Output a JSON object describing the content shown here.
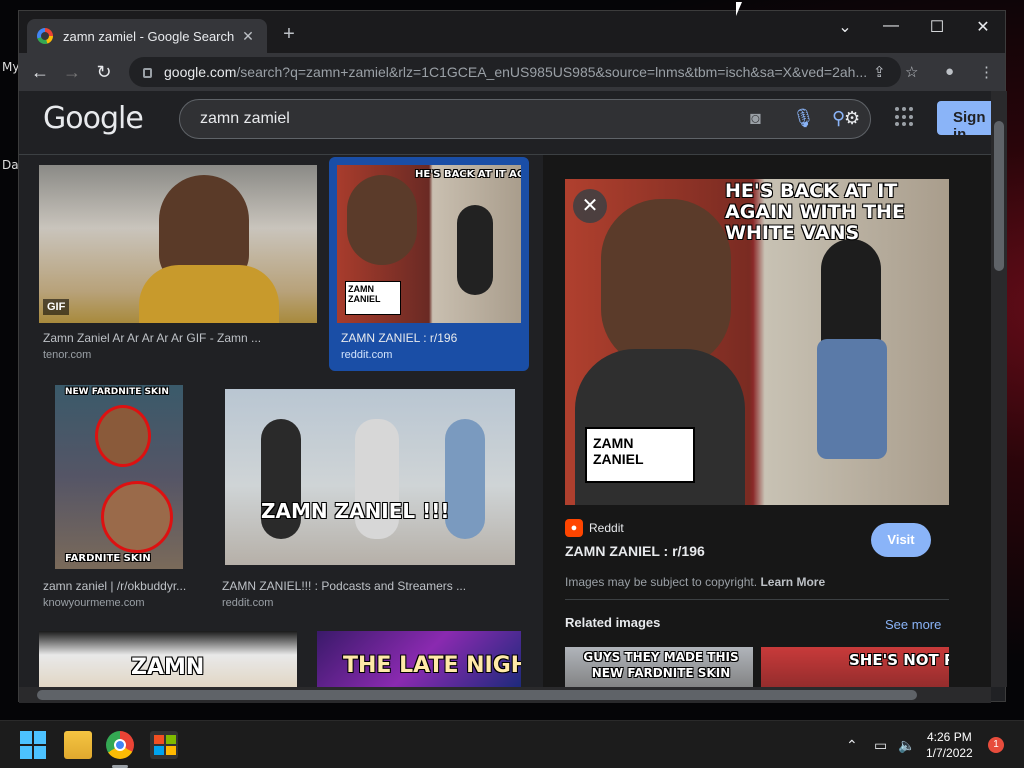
{
  "desktop": {
    "label_my": "My",
    "label_da": "Da"
  },
  "browser": {
    "tab_title": "zamn zamiel - Google Search",
    "url_host": "google.com",
    "url_path": "/search?q=zamn+zamiel&rlz=1C1GCEA_enUS985US985&source=lnms&tbm=isch&sa=X&ved=2ah..."
  },
  "google": {
    "logo": "Google",
    "search_query": "zamn zamiel",
    "signin_label": "Sign in"
  },
  "results": [
    {
      "title": "Zamn Zaniel Ar Ar Ar Ar Ar GIF - Zamn ...",
      "source": "tenor.com",
      "badge": "GIF"
    },
    {
      "title": "ZAMN ZANIEL : r/196",
      "source": "reddit.com",
      "meme_top": "HE'S BACK AT IT AGAIN WITH THE WHITE VANS",
      "meme_label": "ZAMN ZANIEL"
    },
    {
      "title": "zamn zaniel | /r/okbuddyr...",
      "source": "knowyourmeme.com",
      "meme_top": "NEW FARDNITE SKIN",
      "meme_bottom": "FARDNITE SKIN"
    },
    {
      "title": "ZAMN ZANIEL!!! : Podcasts and Streamers ...",
      "source": "reddit.com",
      "meme_text": "ZAMN ZANIEL !!!"
    },
    {
      "meme_text": "ZAMN"
    },
    {
      "meme_text": "THE LATE NIGHT"
    }
  ],
  "preview": {
    "source_name": "Reddit",
    "title": "ZAMN ZANIEL : r/196",
    "visit_label": "Visit",
    "copyright_text": "Images may be subject to copyright.",
    "learn_more": "Learn More",
    "related_label": "Related images",
    "see_more": "See more",
    "meme_top": "HE'S BACK AT IT AGAIN WITH THE WHITE VANS",
    "meme_label": "ZAMN ZANIEL",
    "related": [
      {
        "meme_text": "GUYS THEY MADE THIS NEW FARDNITE SKIN"
      },
      {
        "meme_text": "SHE'S NOT REAL"
      }
    ]
  },
  "taskbar": {
    "time": "4:26 PM",
    "date": "1/7/2022",
    "notifications": "1"
  }
}
